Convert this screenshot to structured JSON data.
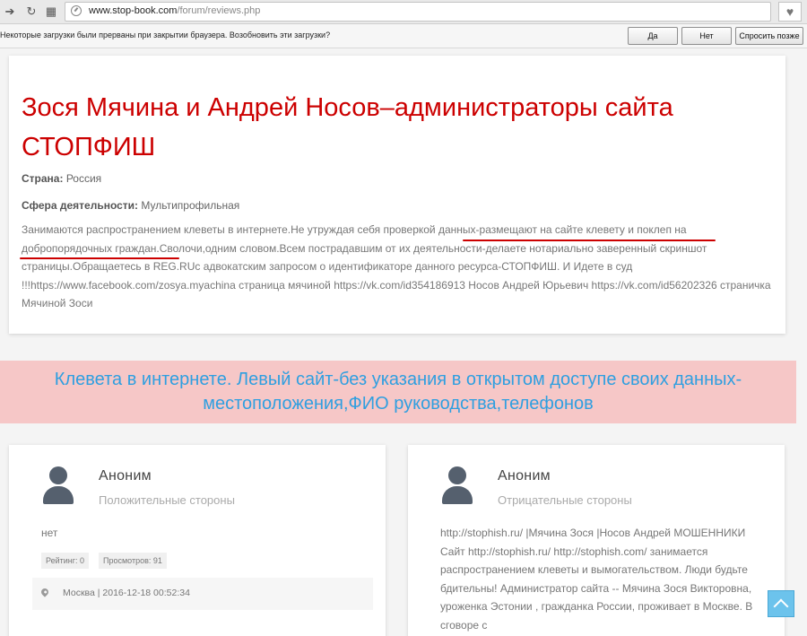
{
  "browser": {
    "url_host": "www.stop-book.com",
    "url_path": "/forum/reviews.php",
    "infobar": {
      "message": "Некоторые загрузки были прерваны при закрытии браузера. Возобновить эти загрузки?",
      "yes": "Да",
      "no": "Нет",
      "later": "Спросить позже"
    }
  },
  "review_main": {
    "title": "Зося Мячина и Андрей Носов–администраторы сайта СТОПФИШ",
    "country_label": "Страна:",
    "country_value": "Россия",
    "field_label": "Сфера деятельности:",
    "field_value": "Мультипрофильная",
    "description": "Занимаются распространением клеветы в интернете.Не утруждая себя проверкой данных-размещают на сайте клевету и поклеп на добропорядочных граждан.Сволочи,одним словом.Всем пострадавшим от их деятельности-делаете нотариально заверенный скриншот страницы.Обращаетесь в REG.RUс адвокатским запросом о идентификаторе данного ресурса-СТОПФИШ. И Идете в суд !!!https://www.facebook.com/zosya.myachina страница мячиной https://vk.com/id354186913 Носов Андрей Юрьевич https://vk.com/id56202326 страничка Мячиной Зоси"
  },
  "banner": {
    "text": "Клевета в интернете. Левый сайт-без указания в открытом доступе своих данных-местоположения,ФИО руководства,телефонов"
  },
  "reviews": [
    {
      "author": "Аноним",
      "type": "Положительные стороны",
      "text": "нет",
      "rating": "Рейтинг: 0",
      "views": "Просмотров: 91",
      "location": "Москва | 2016-12-18 00:52:34"
    },
    {
      "author": "Аноним",
      "type": "Отрицательные стороны",
      "text": "http://stophish.ru/ |Мячина Зося |Носов Андрей МОШЕННИКИ Сайт http://stophish.ru/ http://stophish.com/ занимается распространением клеветы и вымогательством. Люди будьте бдительны! Администратор сайта -- Мячина Зося Викторовна, уроженка Эстонии , гражданка России, проживает в Москве. В сговоре с"
    }
  ],
  "colors": {
    "title_red": "#cc0000",
    "banner_bg": "#f6c7c7",
    "banner_text": "#2f9fe0"
  }
}
